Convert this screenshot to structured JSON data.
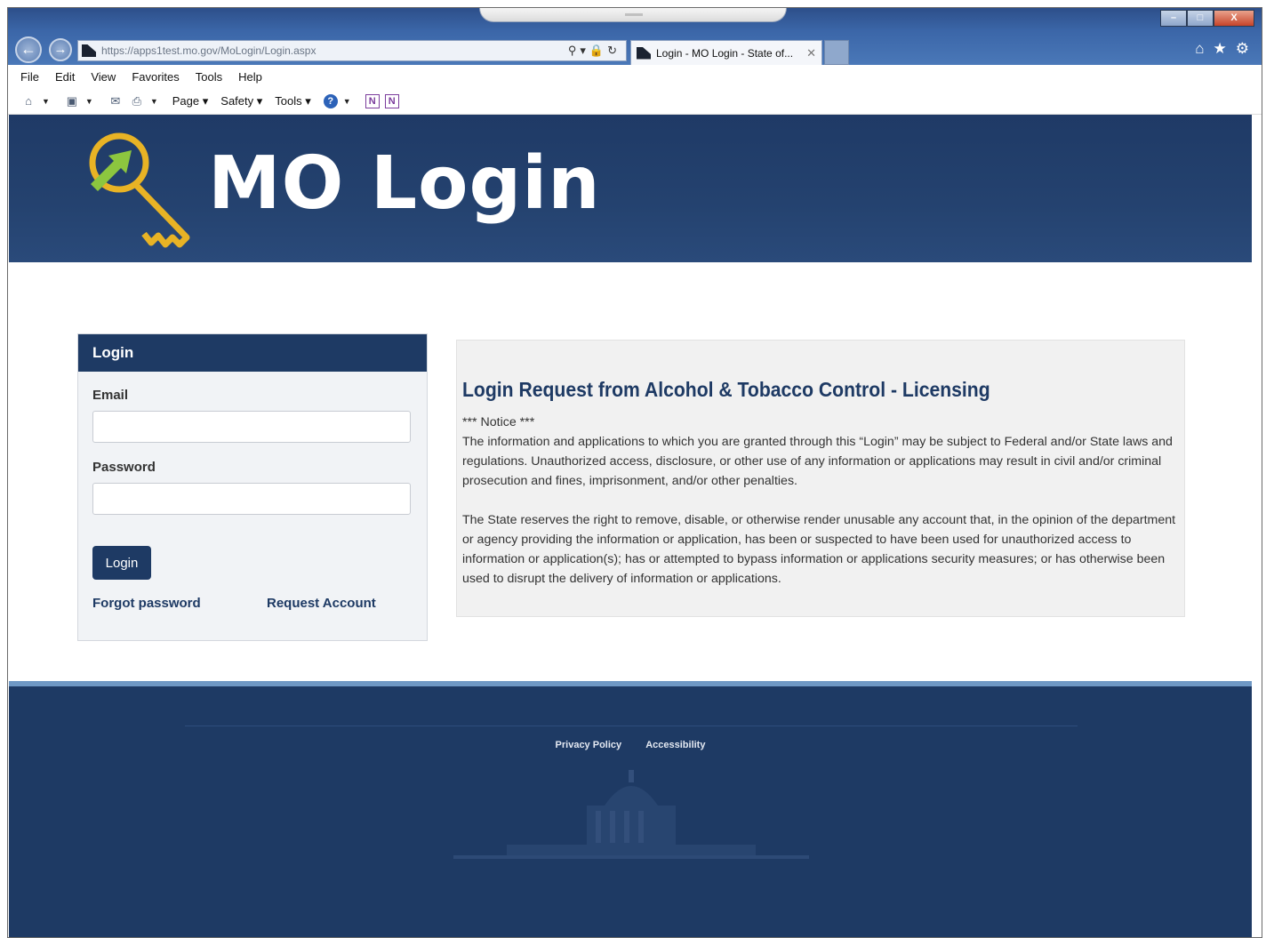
{
  "browser": {
    "url": "https://apps1test.mo.gov/MoLogin/Login.aspx",
    "tab_title": "Login - MO Login - State of...",
    "window_buttons": [
      "–",
      "□",
      "X"
    ]
  },
  "menu": [
    "File",
    "Edit",
    "View",
    "Favorites",
    "Tools",
    "Help"
  ],
  "commandbar": {
    "page": "Page",
    "safety": "Safety",
    "tools": "Tools"
  },
  "banner": {
    "title": "MO Login"
  },
  "login": {
    "heading": "Login",
    "email_label": "Email",
    "email_value": "",
    "password_label": "Password",
    "password_value": "",
    "button": "Login",
    "forgot": "Forgot password",
    "request": "Request Account"
  },
  "notice": {
    "title": "Login Request from  Alcohol & Tobacco Control - Licensing",
    "marker": "*** Notice ***",
    "para1": "The information and applications to which you are granted through this “Login” may be subject to Federal and/or State laws and regulations. Unauthorized access, disclosure, or other use of any information or applications may result in civil and/or criminal prosecution and fines, imprisonment, and/or other penalties.",
    "para2": "The State reserves the right to remove, disable, or otherwise render unusable any account that, in the opinion of the department or agency providing the information or application, has been or suspected to have been used for unauthorized access to information or application(s); has or attempted to bypass information or applications security measures; or has otherwise been used to disrupt the delivery of information or applications."
  },
  "footer": {
    "privacy": "Privacy Policy",
    "accessibility": "Accessibility"
  },
  "colors": {
    "navy": "#1e3a64",
    "key_gold": "#e8b325",
    "arrow_green": "#8cc63f"
  }
}
